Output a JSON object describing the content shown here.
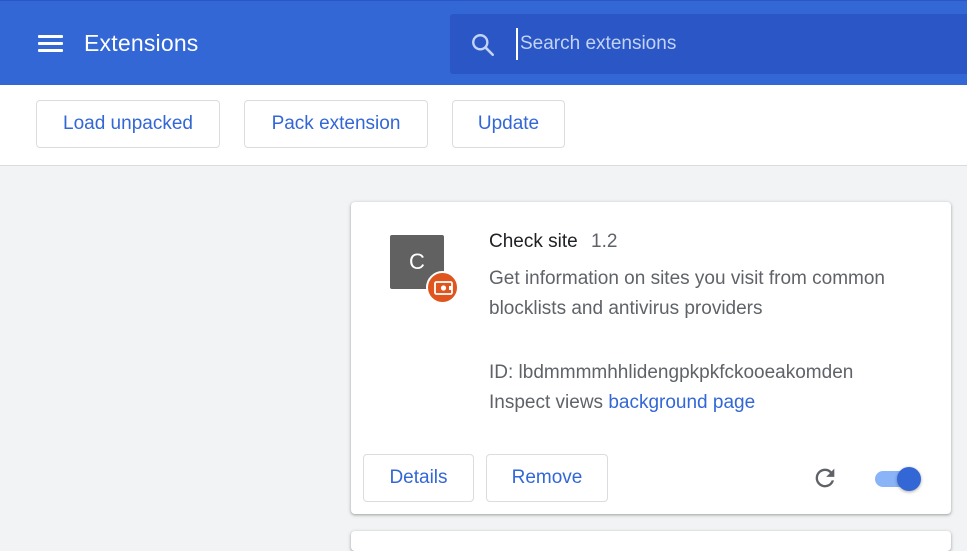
{
  "header": {
    "title": "Extensions",
    "search_placeholder": "Search extensions"
  },
  "toolbar": {
    "load_unpacked": "Load unpacked",
    "pack_extension": "Pack extension",
    "update": "Update"
  },
  "extension": {
    "icon_letter": "C",
    "name": "Check site",
    "version": "1.2",
    "description": "Get information on sites you visit from common blocklists and antivirus providers",
    "id_text": "ID: lbdmmmmhhlidengpkpkfckooeakomden",
    "inspect_label": "Inspect views",
    "inspect_link": "background page",
    "details_label": "Details",
    "remove_label": "Remove",
    "enabled": true
  },
  "colors": {
    "header_bg": "#3367d6",
    "accent": "#3367d6",
    "badge": "#e0541e"
  },
  "icons": {
    "menu": "hamburger-menu-icon",
    "search": "search-icon",
    "reload": "reload-icon",
    "badge": "unpacked-extension-badge-icon"
  }
}
